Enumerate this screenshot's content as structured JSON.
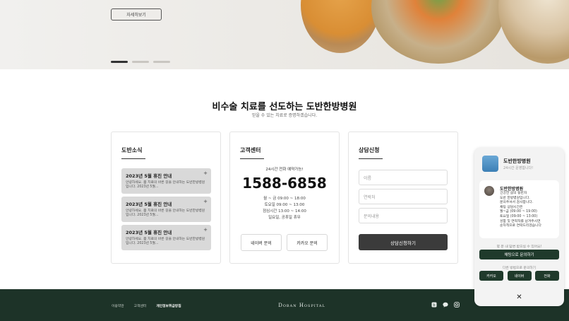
{
  "hero": {
    "detail_button": "자세히보기",
    "slides": [
      {
        "active": true
      },
      {
        "active": false
      },
      {
        "active": false
      }
    ]
  },
  "headline": {
    "title": "비수술 치료를 선도하는 도반한방병원",
    "subtitle": "믿을 수 있는 치료로 증명하겠습니다."
  },
  "news": {
    "title": "도반소식",
    "items": [
      {
        "title": "2023년 5월 휴진 안내",
        "body": "안녕하세요. 몸 치료의 바른 길을 안내하는 도반한방병원 입니다. 2023년 5월..."
      },
      {
        "title": "2023년 5월 휴진 안내",
        "body": "안녕하세요. 몸 치료의 바른 길을 안내하는 도반한방병원 입니다. 2023년 5월..."
      },
      {
        "title": "2023년 5월 휴진 안내",
        "body": "안녕하세요. 몸 치료의 바른 길을 안내하는 도반한방병원 입니다. 2023년 5월..."
      }
    ]
  },
  "customer_center": {
    "title": "고객센터",
    "note": "24시간 전화 예약가능!",
    "phone": "1588-6858",
    "hours": [
      "월 ~ 금 09:00 ~ 18:00",
      "토요일 09:00 ~ 13:00",
      "점심시간 13:00 ~ 14:00",
      "일요일, 공휴일 휴무"
    ],
    "naver_button": "네이버 문의",
    "kakao_button": "카카오 문의"
  },
  "consult": {
    "title": "상담신청",
    "name_placeholder": "이름",
    "phone_placeholder": "연락처",
    "content_placeholder": "문의내용",
    "submit_label": "상담신청하기"
  },
  "footer": {
    "links": [
      "이용약관",
      "고객센터",
      "개인정보취급방침"
    ],
    "logo": "Doban Hospital",
    "icons": [
      "blog-icon",
      "chat-icon",
      "instagram-icon"
    ]
  },
  "chat": {
    "name": "도반한방병원",
    "status": "24시간 운영합니다!",
    "sender": "도반한방병원",
    "message": "건강한 삶의 동반자\n도반 한방병원입니다.\n문의주셔서 감사합니다.\n채팅 상담시간은\n월~금 (09:00 ~ 19:00)\n토요일 (09:00 ~ 13:00)\n성함 및 연락처를 남겨주시면\n순차적으로 연락드리겠습니다",
    "hint": "몇 분 내 답변 받으실 수 있어요!",
    "primary_button": "채팅으로 문의하기",
    "other_label": "다른 방법으로 문의하기",
    "kakao": "카카오",
    "naver": "네이버",
    "phone": "전화",
    "close": "✕"
  },
  "colors": {
    "footer_bg": "#1d3328",
    "chat_button": "#1f3a2b",
    "submit_button": "#3b3b3b"
  }
}
